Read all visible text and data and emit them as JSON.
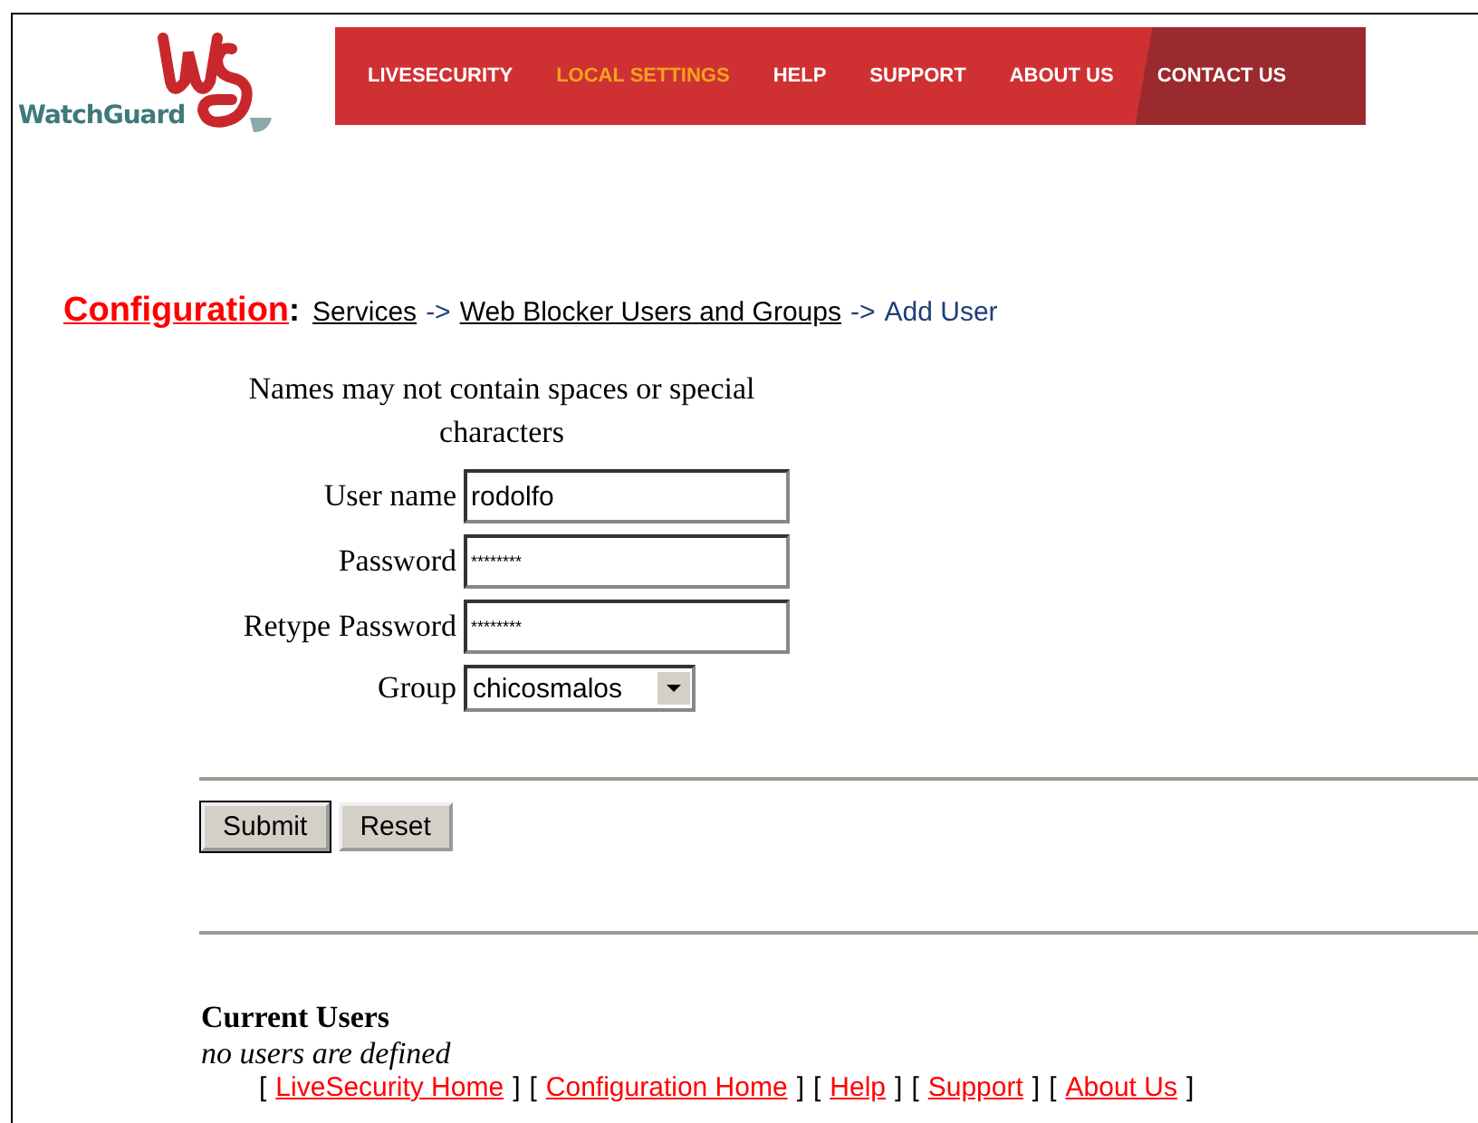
{
  "logo": {
    "text": "WatchGuard"
  },
  "nav": [
    {
      "label": "LIVESECURITY",
      "selected": false
    },
    {
      "label": "LOCAL SETTINGS",
      "selected": true
    },
    {
      "label": "HELP",
      "selected": false
    },
    {
      "label": "SUPPORT",
      "selected": false
    },
    {
      "label": "ABOUT US",
      "selected": false
    },
    {
      "label": "CONTACT US",
      "selected": false
    }
  ],
  "breadcrumb": {
    "title": "Configuration",
    "separator": ":",
    "links": [
      "Services",
      "Web Blocker Users and Groups"
    ],
    "arrow": "->",
    "current": "Add User"
  },
  "form": {
    "note": "Names may not contain spaces or special characters",
    "fields": [
      {
        "label": "User name",
        "kind": "text",
        "value": "rodolfo"
      },
      {
        "label": "Password",
        "kind": "password",
        "value": "********"
      },
      {
        "label": "Retype Password",
        "kind": "password",
        "value": "********"
      },
      {
        "label": "Group",
        "kind": "select",
        "value": "chicosmalos"
      }
    ],
    "buttons": [
      {
        "label": "Submit",
        "default": true
      },
      {
        "label": "Reset",
        "default": false
      }
    ]
  },
  "current_users": {
    "heading": "Current Users",
    "empty_text": "no users are defined"
  },
  "footer": {
    "open": "[",
    "close": "]",
    "links": [
      "LiveSecurity Home",
      "Configuration Home",
      "Help",
      "Support",
      "About Us"
    ]
  }
}
